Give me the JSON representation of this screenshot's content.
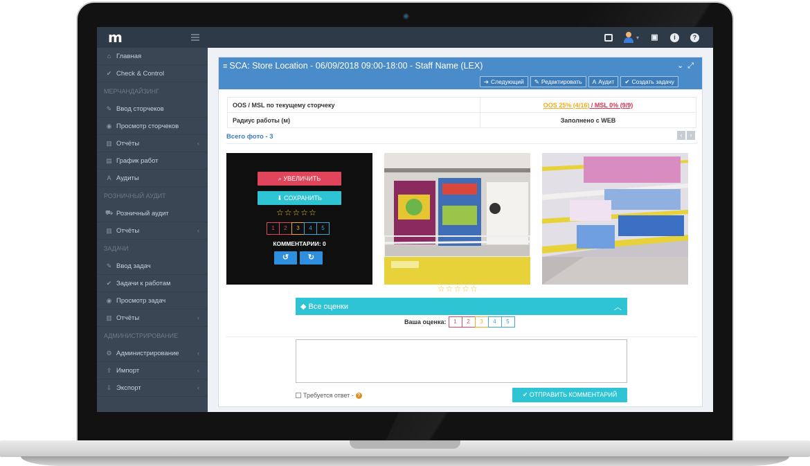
{
  "app": {
    "logo": "m"
  },
  "sidebar": {
    "items": [
      {
        "type": "item",
        "icon": "home-icon",
        "glyph": "⌂",
        "label": "Главная"
      },
      {
        "type": "item",
        "icon": "check-icon",
        "glyph": "✔",
        "label": "Check & Control"
      },
      {
        "type": "section",
        "label": "МЕРЧАНДАЙЗИНГ"
      },
      {
        "type": "item",
        "icon": "edit-icon",
        "glyph": "✎",
        "label": "Ввод сторчеков"
      },
      {
        "type": "item",
        "icon": "eye-icon",
        "glyph": "◉",
        "label": "Просмотр сторчеков"
      },
      {
        "type": "item",
        "icon": "bar-chart-icon",
        "glyph": "▥",
        "label": "Отчёты",
        "chevron": true
      },
      {
        "type": "item",
        "icon": "calendar-icon",
        "glyph": "▤",
        "label": "График работ"
      },
      {
        "type": "item",
        "icon": "font-icon",
        "glyph": "A",
        "label": "Аудиты"
      },
      {
        "type": "section",
        "label": "РОЗНИЧНЫЙ АУДИТ"
      },
      {
        "type": "item",
        "icon": "cart-icon",
        "glyph": "⛟",
        "label": "Розничный аудит"
      },
      {
        "type": "item",
        "icon": "bar-chart-icon",
        "glyph": "▥",
        "label": "Отчёты",
        "chevron": true
      },
      {
        "type": "section",
        "label": "ЗАДАЧИ"
      },
      {
        "type": "item",
        "icon": "edit-icon",
        "glyph": "✎",
        "label": "Ввод задач"
      },
      {
        "type": "item",
        "icon": "check-icon",
        "glyph": "✔",
        "label": "Задачи к работам"
      },
      {
        "type": "item",
        "icon": "eye-icon",
        "glyph": "◉",
        "label": "Просмотр задач"
      },
      {
        "type": "item",
        "icon": "bar-chart-icon",
        "glyph": "▥",
        "label": "Отчёты",
        "chevron": true
      },
      {
        "type": "section",
        "label": "АДМИНИСТРИРОВАНИЕ"
      },
      {
        "type": "item",
        "icon": "gears-icon",
        "glyph": "⚙",
        "label": "Администрирование",
        "chevron": true
      },
      {
        "type": "item",
        "icon": "upload-icon",
        "glyph": "⇪",
        "label": "Импорт",
        "chevron": true
      },
      {
        "type": "item",
        "icon": "download-icon",
        "glyph": "⇩",
        "label": "Экспорт",
        "chevron": true
      }
    ]
  },
  "panel": {
    "title": "SCA: Store Location - 06/09/2018 09:00-18:00 - Staff Name (LEX)",
    "buttons": [
      {
        "name": "next-button",
        "glyph": "➔",
        "label": "Следующий"
      },
      {
        "name": "edit-button",
        "glyph": "✎",
        "label": "Редактировать"
      },
      {
        "name": "audit-button",
        "glyph": "A",
        "label": "Аудит"
      },
      {
        "name": "create-task-button",
        "glyph": "✔",
        "label": "Создать задачу"
      }
    ]
  },
  "info": {
    "row1_label": "OOS / MSL по текущему сторчеку",
    "oos": "OOS 25% (4/16)",
    "separator": " / ",
    "msl": "MSL 0% (9/9)",
    "row2_label": "Радиус работы (м)",
    "row2_value": "Заполнено с WEB"
  },
  "photos": {
    "count_label": "Всего фото - 3",
    "zoom_label": "УВЕЛИЧИТЬ",
    "save_label": "СОХРАНИТЬ",
    "stars": "☆☆☆☆☆",
    "rating_options": [
      "1",
      "2",
      "3",
      "4",
      "5"
    ],
    "comments_label": "КОММЕНТАРИИ: 0"
  },
  "ratings": {
    "all_label": "Все оценки",
    "your_label": "Ваша оценка:",
    "options": [
      "1",
      "2",
      "3",
      "4",
      "5"
    ]
  },
  "comment": {
    "placeholder": "",
    "requires_answer_label": "Требуется ответ -",
    "send_label": "ОТПРАВИТЬ КОММЕНТАРИЙ"
  },
  "colors": {
    "header": "#2e3a47",
    "sidebar": "#3a4654",
    "panel_header": "#4a8bc9",
    "accent_teal": "#2ec4d3",
    "accent_red": "#e0455b",
    "accent_yellow": "#f0ad1e"
  }
}
